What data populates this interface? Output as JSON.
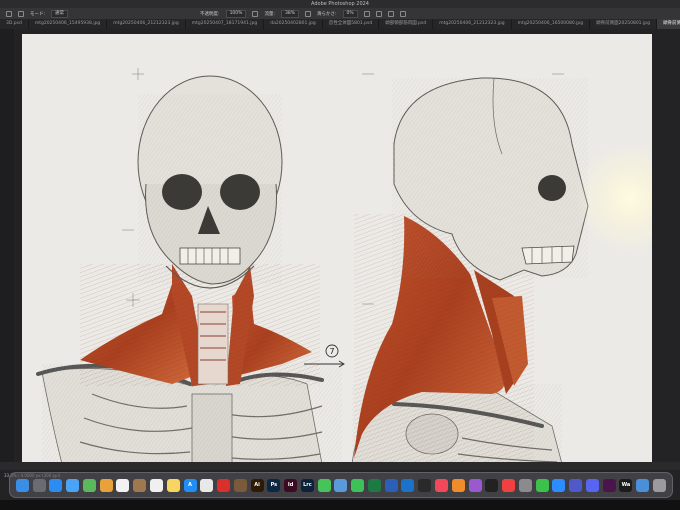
{
  "window": {
    "title": "Adobe Photoshop 2024"
  },
  "options_bar": {
    "mode_label": "モード:",
    "mode_value": "通常",
    "opacity_label": "不透明度:",
    "opacity_value": "100%",
    "flow_label": "流量:",
    "flow_value": "38%",
    "smoothing_label": "滑らかさ:",
    "smoothing_value": "0%"
  },
  "tabs": [
    {
      "label": "3D.psd",
      "active": false
    },
    {
      "label": "mtg20250406_15495938.jpg",
      "active": false
    },
    {
      "label": "mtg20250406_21212323.jpg",
      "active": false
    },
    {
      "label": "mtg20250407_18171941.jpg",
      "active": false
    },
    {
      "label": "da20250402801.jpg",
      "active": false
    },
    {
      "label": "首性全体図5801.psd",
      "active": false
    },
    {
      "label": "頭部頸部筋肉図.psd",
      "active": false
    },
    {
      "label": "mtg20250406_21212323.jpg",
      "active": false
    },
    {
      "label": "mtg20250406_16500080.jpg",
      "active": false
    },
    {
      "label": "頭骨前側面20250801.jpg",
      "active": false
    },
    {
      "label": "頭骨前側面20250801.psd @ 33.3% (レイヤー...",
      "active": true
    }
  ],
  "status": {
    "zoom_doc": "33.3% / 4.0000 px (300 ppi)"
  },
  "canvas": {
    "annotation_number": "7"
  },
  "dock": {
    "apps": [
      {
        "icon": "finder-icon",
        "label": "",
        "color": "#3a8ee6"
      },
      {
        "icon": "launchpad-icon",
        "label": "",
        "color": "#6b6b73"
      },
      {
        "icon": "safari-icon",
        "label": "",
        "color": "#2d8cf0"
      },
      {
        "icon": "mail-icon",
        "label": "",
        "color": "#4aa3f5"
      },
      {
        "icon": "maps-icon",
        "label": "",
        "color": "#5cb85c"
      },
      {
        "icon": "photos-icon",
        "label": "",
        "color": "#e9a23b"
      },
      {
        "icon": "calendar-icon",
        "label": "",
        "color": "#f2f2f2"
      },
      {
        "icon": "contacts-icon",
        "label": "",
        "color": "#a07850"
      },
      {
        "icon": "reminders-icon",
        "label": "",
        "color": "#f0f0f0"
      },
      {
        "icon": "notes-icon",
        "label": "",
        "color": "#f7d560"
      },
      {
        "icon": "appstore-icon",
        "label": "A",
        "color": "#1f8ff5"
      },
      {
        "icon": "chrome-icon",
        "label": "",
        "color": "#e8e8e8"
      },
      {
        "icon": "acrobat-icon",
        "label": "",
        "color": "#d9302c"
      },
      {
        "icon": "bridge-icon",
        "label": "",
        "color": "#7a5a3a"
      },
      {
        "icon": "illustrator-icon",
        "label": "Ai",
        "color": "#2e1b05"
      },
      {
        "icon": "photoshop-icon",
        "label": "Ps",
        "color": "#0c2840"
      },
      {
        "icon": "indesign-icon",
        "label": "Id",
        "color": "#3b0b22"
      },
      {
        "icon": "lightroom-icon",
        "label": "Lrc",
        "color": "#0b2238"
      },
      {
        "icon": "messages-icon",
        "label": "",
        "color": "#48c35a"
      },
      {
        "icon": "preview-icon",
        "label": "",
        "color": "#5a9ad8"
      },
      {
        "icon": "facetime-icon",
        "label": "",
        "color": "#3ec15a"
      },
      {
        "icon": "excel-icon",
        "label": "",
        "color": "#1d7a43"
      },
      {
        "icon": "word-icon",
        "label": "",
        "color": "#2b5fb8"
      },
      {
        "icon": "outlook-icon",
        "label": "",
        "color": "#1a73c9"
      },
      {
        "icon": "terminal-icon",
        "label": "",
        "color": "#2a2a2a"
      },
      {
        "icon": "music-icon",
        "label": "",
        "color": "#f04a5a"
      },
      {
        "icon": "books-icon",
        "label": "",
        "color": "#f08c2a"
      },
      {
        "icon": "podcasts-icon",
        "label": "",
        "color": "#9b59d0"
      },
      {
        "icon": "tv-icon",
        "label": "",
        "color": "#222"
      },
      {
        "icon": "news-icon",
        "label": "",
        "color": "#f04040"
      },
      {
        "icon": "settings-icon",
        "label": "",
        "color": "#8a8a8f"
      },
      {
        "icon": "line-icon",
        "label": "",
        "color": "#3cc24a"
      },
      {
        "icon": "zoom-icon",
        "label": "",
        "color": "#2d8cff"
      },
      {
        "icon": "teams-icon",
        "label": "",
        "color": "#5059c9"
      },
      {
        "icon": "discord-icon",
        "label": "",
        "color": "#5865f2"
      },
      {
        "icon": "slack-icon",
        "label": "",
        "color": "#4a154b"
      },
      {
        "icon": "wacom-icon",
        "label": "Wa",
        "color": "#1c1c1c"
      },
      {
        "icon": "downloads-icon",
        "label": "",
        "color": "#4a90d9"
      },
      {
        "icon": "trash-icon",
        "label": "",
        "color": "#9a9aa0"
      }
    ]
  }
}
